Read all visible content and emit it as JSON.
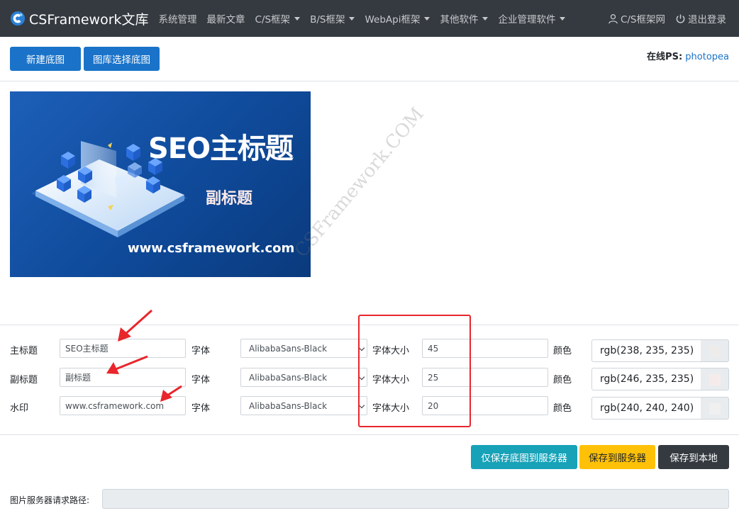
{
  "navbar": {
    "brand": "CSFramework文库",
    "items": [
      {
        "label": "系统管理",
        "dropdown": false
      },
      {
        "label": "最新文章",
        "dropdown": false
      },
      {
        "label": "C/S框架",
        "dropdown": true
      },
      {
        "label": "B/S框架",
        "dropdown": true
      },
      {
        "label": "WebApi框架",
        "dropdown": true
      },
      {
        "label": "其他软件",
        "dropdown": true
      },
      {
        "label": "企业管理软件",
        "dropdown": true
      }
    ],
    "right": {
      "site_link": "C/S框架网",
      "logout": "退出登录"
    }
  },
  "toolbar": {
    "new_base": "新建底图",
    "gallery_base": "图库选择底图",
    "online_ps_label": "在线PS:",
    "online_ps_link": "photopea"
  },
  "preview": {
    "title_text": "SEO主标题",
    "subtitle_text": "副标题",
    "watermark_text": "www.csframework.com"
  },
  "page_watermark": "CSFramework.COM",
  "form": {
    "font_label": "字体",
    "size_label": "字体大小",
    "color_label": "颜色",
    "rows": [
      {
        "label": "主标题",
        "text": "SEO主标题",
        "font": "AlibabaSans-Black",
        "size": "45",
        "color": "rgb(238, 235, 235)",
        "swatch": "#eeebeb"
      },
      {
        "label": "副标题",
        "text": "副标题",
        "font": "AlibabaSans-Black",
        "size": "25",
        "color": "rgb(246, 235, 235)",
        "swatch": "#f6ebeb"
      },
      {
        "label": "水印",
        "text": "www.csframework.com",
        "font": "AlibabaSans-Black",
        "size": "20",
        "color": "rgb(240, 240, 240)",
        "swatch": "#f0f0f0"
      }
    ]
  },
  "actions": {
    "save_base_server": "仅保存底图到服务器",
    "save_server": "保存到服务器",
    "save_local": "保存到本地"
  },
  "path": {
    "label": "图片服务器请求路径:",
    "value": ""
  },
  "colors": {
    "navbar_bg": "#343a40",
    "primary": "#1a73c9",
    "info": "#17a2b8",
    "warning": "#ffc107",
    "dark": "#343a40",
    "annotation_red": "#e8262c"
  }
}
